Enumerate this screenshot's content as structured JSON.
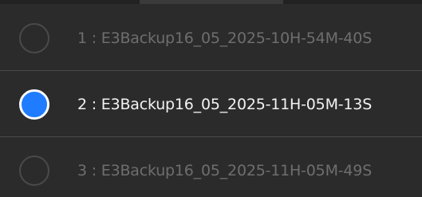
{
  "options": [
    {
      "label": "1 : E3Backup16_05_2025-10H-54M-40S",
      "selected": false
    },
    {
      "label": "2 : E3Backup16_05_2025-11H-05M-13S",
      "selected": true
    },
    {
      "label": "3 : E3Backup16_05_2025-11H-05M-49S",
      "selected": false
    }
  ],
  "colors": {
    "background": "#2b2b2b",
    "divider": "#4a4a4a",
    "radio_selected_fill": "#1f7cff",
    "text_active": "#f2f2f2",
    "text_inactive": "#6e6e6e"
  }
}
